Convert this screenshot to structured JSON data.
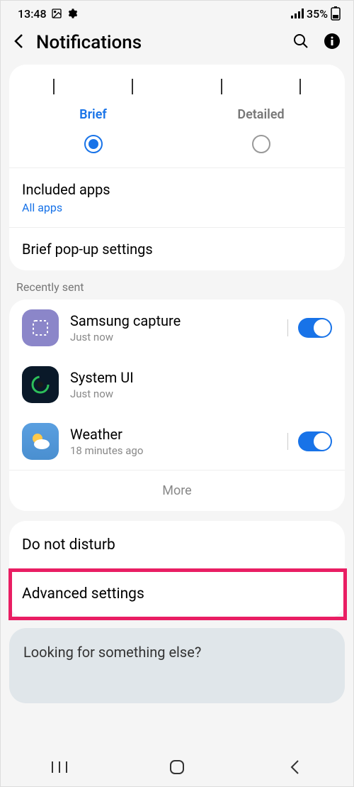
{
  "status": {
    "time": "13:48",
    "battery_text": "35%"
  },
  "header": {
    "title": "Notifications"
  },
  "styles": {
    "brief": "Brief",
    "detailed": "Detailed",
    "selected": "brief"
  },
  "included_apps": {
    "title": "Included apps",
    "subtitle": "All apps"
  },
  "brief_popup": {
    "title": "Brief pop-up settings"
  },
  "recently_sent": {
    "label": "Recently sent",
    "apps": [
      {
        "name": "Samsung capture",
        "time": "Just now",
        "toggle": true,
        "icon": "capture"
      },
      {
        "name": "System UI",
        "time": "Just now",
        "toggle": null,
        "icon": "systemui"
      },
      {
        "name": "Weather",
        "time": "18 minutes ago",
        "toggle": true,
        "icon": "weather"
      }
    ],
    "more": "More"
  },
  "settings": {
    "dnd": "Do not disturb",
    "advanced": "Advanced settings"
  },
  "footer": {
    "text": "Looking for something else?"
  }
}
